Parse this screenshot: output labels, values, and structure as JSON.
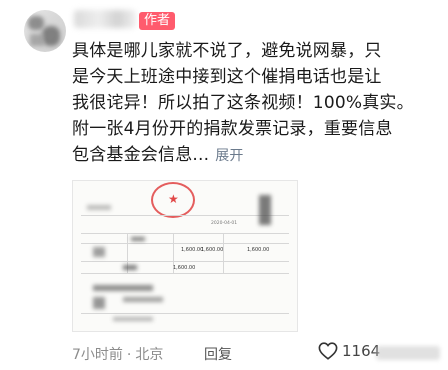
{
  "comment": {
    "author_badge": "作者",
    "lines": [
      "具体是哪儿家就不说了，避免说网暴，只",
      "是今天上班途中接到这个催捐电话也是让",
      "我很诧异！所以拍了这条视频！100%真实。",
      "附一张4月份开的捐款发票记录，重要信息",
      "包含基金会信息..."
    ],
    "expand_label": "展开"
  },
  "receipt": {
    "amount_1": "1,600.00",
    "amount_2": "1,600.00",
    "amount_3": "1,600.00",
    "total": "1,600.00",
    "date": "2020-04-01"
  },
  "meta": {
    "time": "7小时前",
    "location": "北京",
    "reply_label": "回复"
  },
  "like": {
    "count": "1164",
    "icon": "heart-outline-icon"
  },
  "colors": {
    "badge": "#ff5b6d",
    "text": "#1a1a1a",
    "muted": "#8c8c8c",
    "link": "#6b7a8c"
  }
}
